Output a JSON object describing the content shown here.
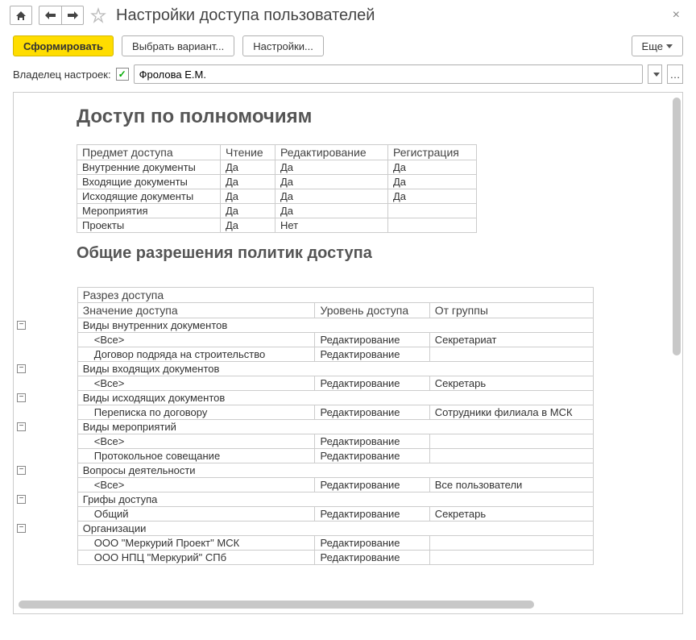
{
  "header": {
    "title": "Настройки доступа пользователей"
  },
  "toolbar": {
    "generate": "Сформировать",
    "choose_variant": "Выбрать вариант...",
    "settings": "Настройки...",
    "more": "Еще"
  },
  "owner": {
    "label": "Владелец настроек:",
    "value": "Фролова Е.М."
  },
  "section1": {
    "title": "Доступ по полномочиям",
    "columns": {
      "subject": "Предмет доступа",
      "read": "Чтение",
      "edit": "Редактирование",
      "reg": "Регистрация"
    },
    "rows": [
      {
        "subject": "Внутренние документы",
        "read": "Да",
        "edit": "Да",
        "reg": "Да"
      },
      {
        "subject": "Входящие документы",
        "read": "Да",
        "edit": "Да",
        "reg": "Да"
      },
      {
        "subject": "Исходящие документы",
        "read": "Да",
        "edit": "Да",
        "reg": "Да"
      },
      {
        "subject": "Мероприятия",
        "read": "Да",
        "edit": "Да",
        "reg": ""
      },
      {
        "subject": "Проекты",
        "read": "Да",
        "edit": "Нет",
        "reg": ""
      }
    ]
  },
  "section2": {
    "title": "Общие разрешения политик доступа",
    "header_top": "Разрез доступа",
    "columns": {
      "value": "Значение доступа",
      "level": "Уровень доступа",
      "group": "От группы"
    },
    "groups": [
      {
        "name": "Виды внутренних документов",
        "children": [
          {
            "value": "<Все>",
            "level": "Редактирование",
            "group": "Секретариат"
          },
          {
            "value": "Договор подряда на строительство",
            "level": "Редактирование",
            "group": ""
          }
        ]
      },
      {
        "name": "Виды входящих документов",
        "children": [
          {
            "value": "<Все>",
            "level": "Редактирование",
            "group": "Секретарь"
          }
        ]
      },
      {
        "name": "Виды исходящих документов",
        "children": [
          {
            "value": "Переписка по договору",
            "level": "Редактирование",
            "group": "Сотрудники филиала в МСК"
          }
        ]
      },
      {
        "name": "Виды мероприятий",
        "children": [
          {
            "value": "<Все>",
            "level": "Редактирование",
            "group": ""
          },
          {
            "value": "Протокольное совещание",
            "level": "Редактирование",
            "group": ""
          }
        ]
      },
      {
        "name": "Вопросы деятельности",
        "children": [
          {
            "value": "<Все>",
            "level": "Редактирование",
            "group": "Все пользователи"
          }
        ]
      },
      {
        "name": "Грифы доступа",
        "children": [
          {
            "value": "Общий",
            "level": "Редактирование",
            "group": "Секретарь"
          }
        ]
      },
      {
        "name": "Организации",
        "children": [
          {
            "value": "ООО \"Меркурий Проект\" МСК",
            "level": "Редактирование",
            "group": ""
          },
          {
            "value": "ООО НПЦ \"Меркурий\" СПб",
            "level": "Редактирование",
            "group": ""
          }
        ]
      }
    ]
  }
}
